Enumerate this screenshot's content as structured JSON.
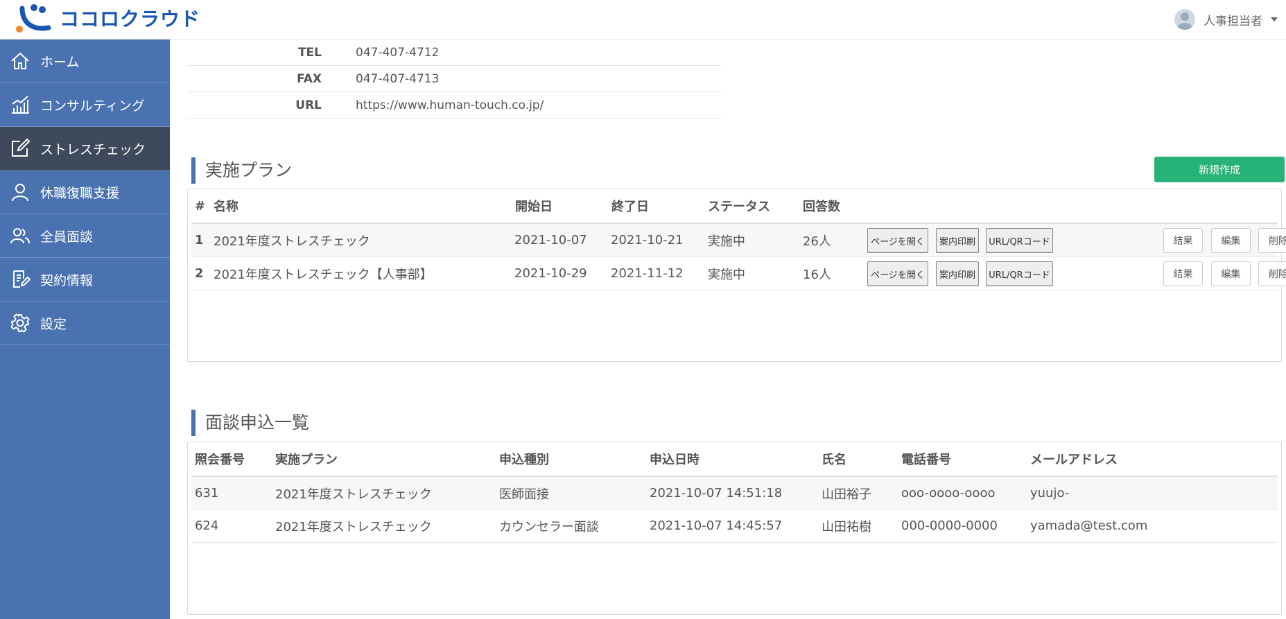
{
  "header": {
    "brand": "ココロクラウド",
    "user_name": "人事担当者"
  },
  "sidebar": {
    "items": [
      {
        "label": "ホーム",
        "icon": "home-icon"
      },
      {
        "label": "コンサルティング",
        "icon": "chart-icon"
      },
      {
        "label": "ストレスチェック",
        "icon": "edit-icon",
        "active": true
      },
      {
        "label": "休職復職支援",
        "icon": "person-icon"
      },
      {
        "label": "全員面談",
        "icon": "people-icon"
      },
      {
        "label": "契約情報",
        "icon": "document-icon"
      },
      {
        "label": "設定",
        "icon": "gear-icon"
      }
    ]
  },
  "company_info": {
    "rows": [
      {
        "label": "TEL",
        "value": "047-407-4712"
      },
      {
        "label": "FAX",
        "value": "047-407-4713"
      },
      {
        "label": "URL",
        "value": "https://www.human-touch.co.jp/"
      }
    ]
  },
  "plans": {
    "title": "実施プラン",
    "new_button": "新規作成",
    "columns": [
      "#",
      "名称",
      "開始日",
      "終了日",
      "ステータス",
      "回答数"
    ],
    "rows": [
      {
        "no": "1",
        "name": "2021年度ストレスチェック",
        "start": "2021-10-07",
        "end": "2021-10-21",
        "status": "実施中",
        "answers": "26人"
      },
      {
        "no": "2",
        "name": "2021年度ストレスチェック【人事部】",
        "start": "2021-10-29",
        "end": "2021-11-12",
        "status": "実施中",
        "answers": "16人"
      }
    ],
    "actions": {
      "open_page": "ページを開く",
      "print_guide": "案内印刷",
      "url_qr": "URL/QRコード",
      "results": "結果",
      "edit": "編集",
      "delete": "削除"
    }
  },
  "interviews": {
    "title": "面談申込一覧",
    "columns": [
      "照会番号",
      "実施プラン",
      "申込種別",
      "申込日時",
      "氏名",
      "電話番号",
      "メールアドレス"
    ],
    "rows": [
      {
        "ref": "631",
        "plan": "2021年度ストレスチェック",
        "type": "医師面接",
        "datetime": "2021-10-07 14:51:18",
        "name": "山田裕子",
        "phone": "ooo-oooo-oooo",
        "email": "yuujo-"
      },
      {
        "ref": "624",
        "plan": "2021年度ストレスチェック",
        "type": "カウンセラー面談",
        "datetime": "2021-10-07 14:45:57",
        "name": "山田祐樹",
        "phone": "000-0000-0000",
        "email": "yamada@test.com"
      }
    ]
  },
  "colors": {
    "sidebar": "#4a72b0",
    "sidebar_active": "#3e4a5c",
    "accent_green": "#27b277",
    "brand_blue": "#1a55b4"
  }
}
